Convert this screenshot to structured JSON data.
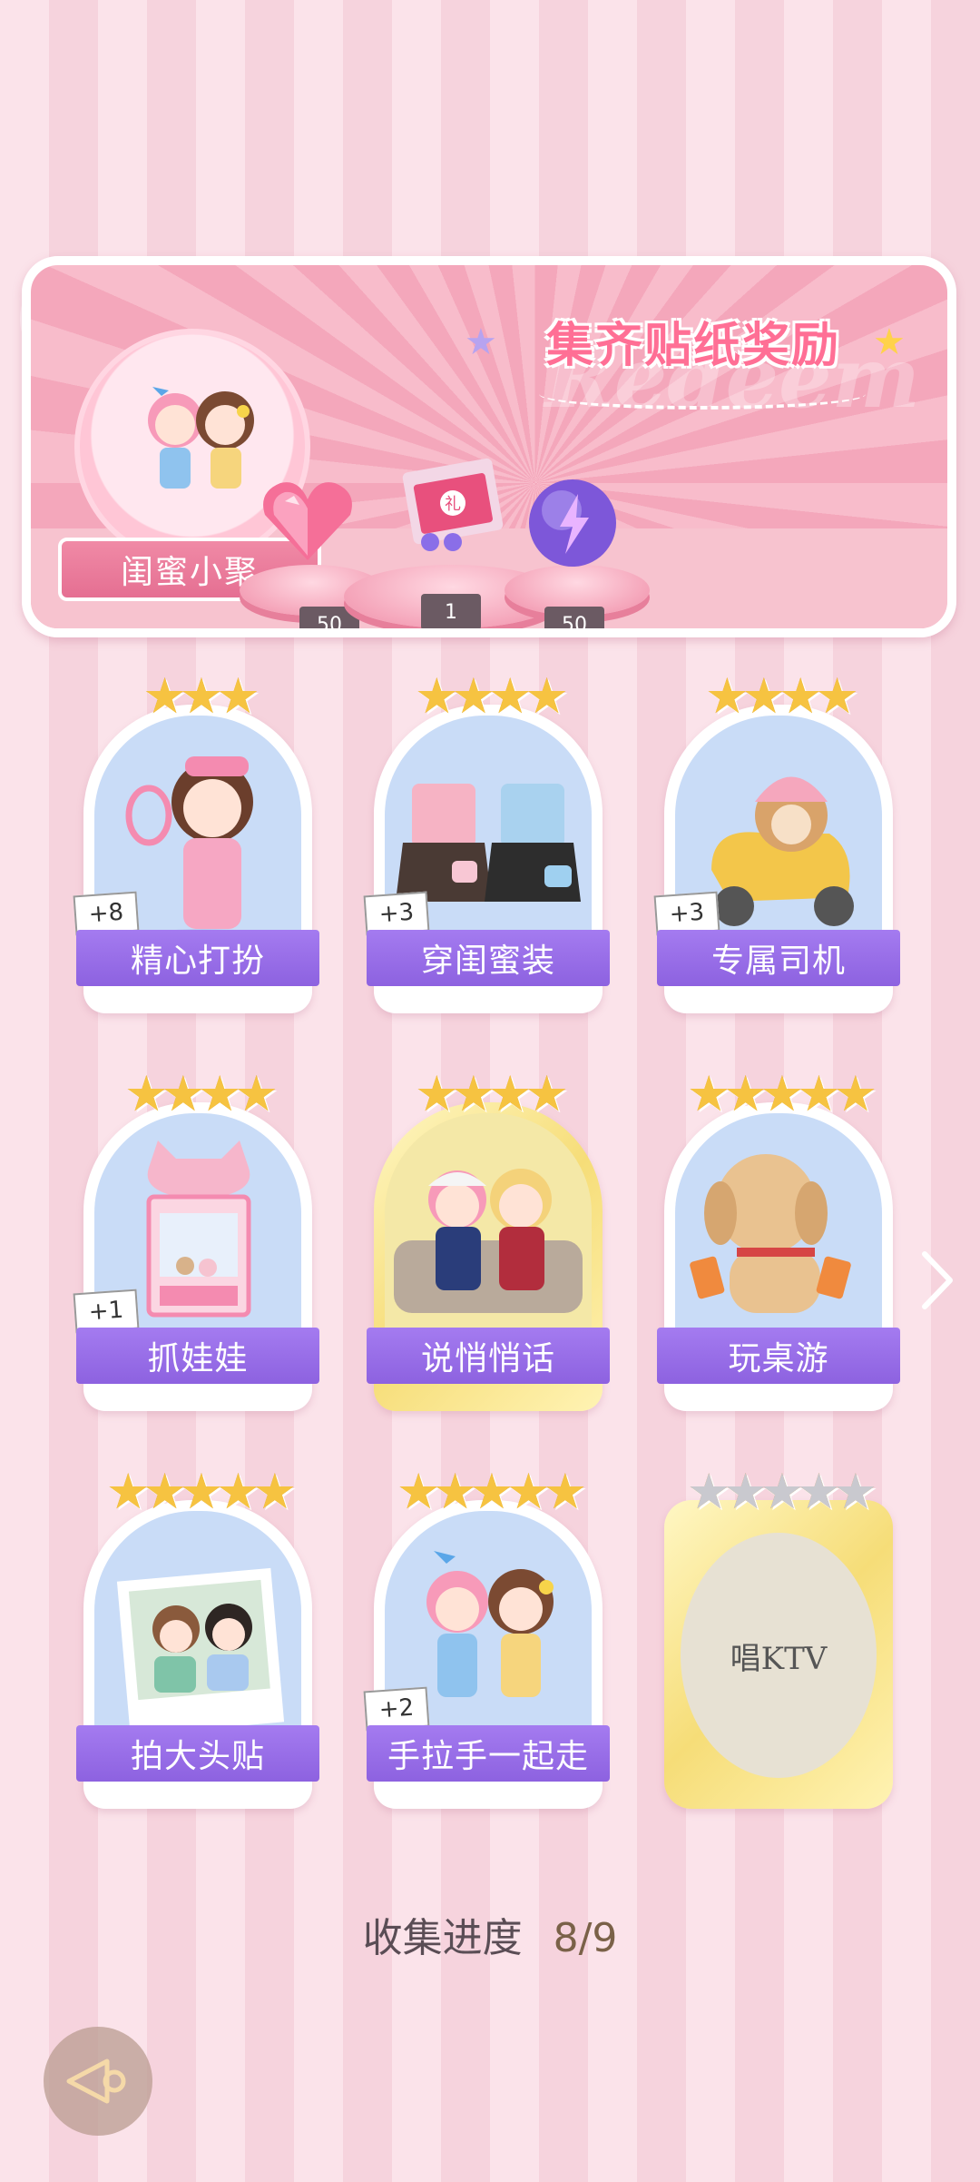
{
  "panel": {
    "title": "集齐贴纸奖励",
    "watermark": "Redeem",
    "set_name": "闺蜜小聚",
    "rewards": [
      {
        "icon": "heart-gem-icon",
        "count": "50"
      },
      {
        "icon": "gift-box-icon",
        "count": "1"
      },
      {
        "icon": "lightning-orb-icon",
        "count": "50"
      }
    ]
  },
  "cards": [
    {
      "label": "精心打扮",
      "stars": "★★★",
      "plus": "+8"
    },
    {
      "label": "穿闺蜜装",
      "stars": "★★★★",
      "plus": "+3"
    },
    {
      "label": "专属司机",
      "stars": "★★★★",
      "plus": "+3"
    },
    {
      "label": "抓娃娃",
      "stars": "★★★★",
      "plus": "+1"
    },
    {
      "label": "说悄悄话",
      "stars": "★★★★"
    },
    {
      "label": "玩桌游",
      "stars": "★★★★★"
    },
    {
      "label": "拍大头贴",
      "stars": "★★★★★"
    },
    {
      "label": "手拉手一起走",
      "stars": "★★★★★",
      "plus": "+2"
    },
    {
      "label": "唱KTV",
      "stars": "★★★★★"
    }
  ],
  "progress": {
    "label": "收集进度",
    "value": "8/9"
  }
}
